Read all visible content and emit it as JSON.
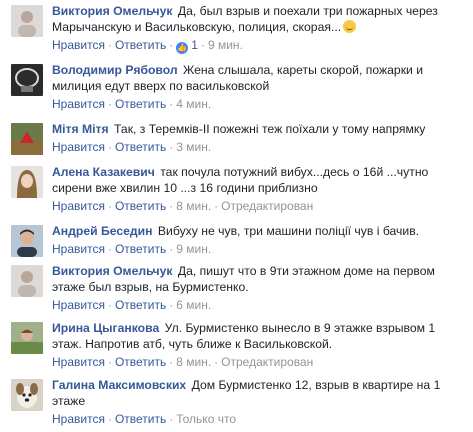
{
  "colors": {
    "author_link": "#365899",
    "meta_gray": "#90949c",
    "text": "#1d2129",
    "like_blue": "#4080ff"
  },
  "actions": {
    "like": "Нравится",
    "reply": "Ответить"
  },
  "comments": [
    {
      "author": "Виктория Омельчук",
      "text": "Да, был взрыв и поехали три пожарных через Марычанскую и Васильковскую, полиция, скорая...",
      "emoji": "relieved-face-emoji",
      "likes": "1",
      "time": "9 мин.",
      "edited": ""
    },
    {
      "author": "Володимир Рябовол",
      "text": "Жена слышала, кареты скорой, пожарки и милиция едут вверх по васильковской",
      "likes": "",
      "time": "4 мин.",
      "edited": ""
    },
    {
      "author": "Мітя Мітя",
      "text": "Так, з Теремків-II пожежні теж поїхали у тому напрямку",
      "likes": "",
      "time": "3 мин.",
      "edited": ""
    },
    {
      "author": "Алена Казакевич",
      "text": "так почула потужний вибух...десь о 16й ...чутно сирени вже хвилин 10 ...з 16 години приблизно",
      "likes": "",
      "time": "8 мин.",
      "edited": "Отредактирован"
    },
    {
      "author": "Андрей Беседин",
      "text": "Вибуху не чув, три машини поліції чув і бачив.",
      "likes": "",
      "time": "9 мин.",
      "edited": ""
    },
    {
      "author": "Виктория Омельчук",
      "text": "Да, пишут что в 9ти этажном доме на первом этаже был взрыв, на Бурмистенко.",
      "likes": "",
      "time": "6 мин.",
      "edited": ""
    },
    {
      "author": "Ирина Цыганкова",
      "text": "Ул. Бурмистенко вынесло в 9 этажке взрывом 1 этаж. Напротив атб, чуть ближе к Васильковской.",
      "likes": "",
      "time": "8 мин.",
      "edited": "Отредактирован"
    },
    {
      "author": "Галина Максимовских",
      "text": "Дом Бурмистенко 12, взрыв в квартире на 1 этаже",
      "likes": "",
      "time": "Только что",
      "edited": ""
    }
  ]
}
